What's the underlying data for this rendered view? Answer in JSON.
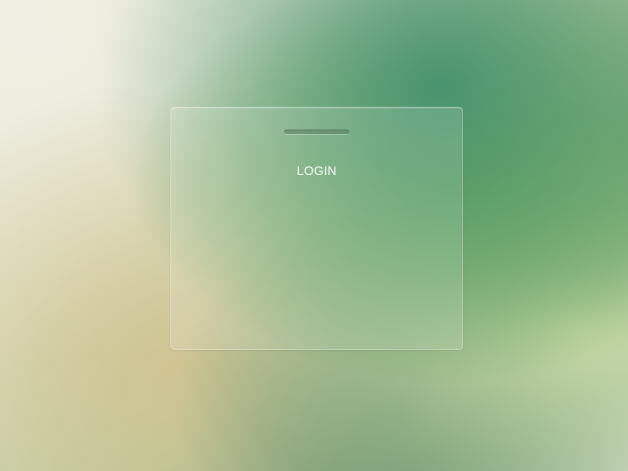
{
  "login_card": {
    "title": "LOGIN"
  },
  "colors": {
    "card_text": "#ffffff",
    "handle": "#4f6e5a"
  }
}
